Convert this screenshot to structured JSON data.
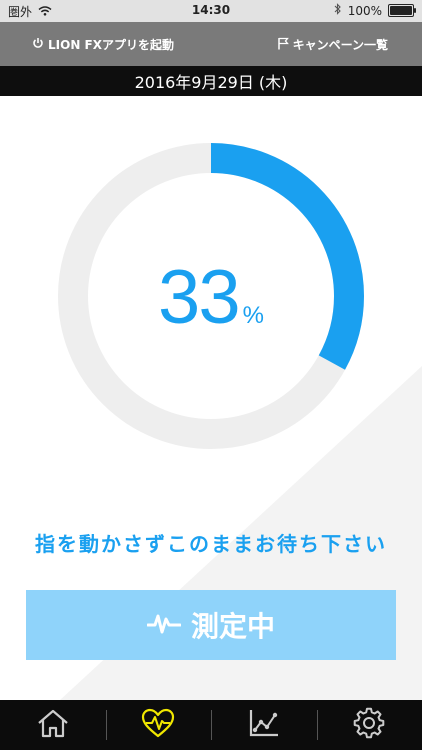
{
  "status": {
    "carrier": "圏外",
    "time": "14:30",
    "battery": "100%",
    "battery_level": 1.0
  },
  "nav": {
    "left_label": "LION FXアプリを起動",
    "right_label": "キャンペーン一覧"
  },
  "date": "2016年9月29日 (木)",
  "progress": {
    "value": "33",
    "unit": "%",
    "fraction": 0.33
  },
  "instruction": "指を動かさずこのままお待ち下さい",
  "measure_button": {
    "label": "測定中"
  },
  "tabs": [
    {
      "icon": "home-icon"
    },
    {
      "icon": "heart-pulse-icon",
      "active": true
    },
    {
      "icon": "chart-icon"
    },
    {
      "icon": "gear-icon"
    }
  ],
  "colors": {
    "accent": "#1aa0f0",
    "ring_track": "#eeeeee",
    "button": "#8fd3fa",
    "active_tab": "#f0e600",
    "navbar": "#7a7a7a"
  }
}
